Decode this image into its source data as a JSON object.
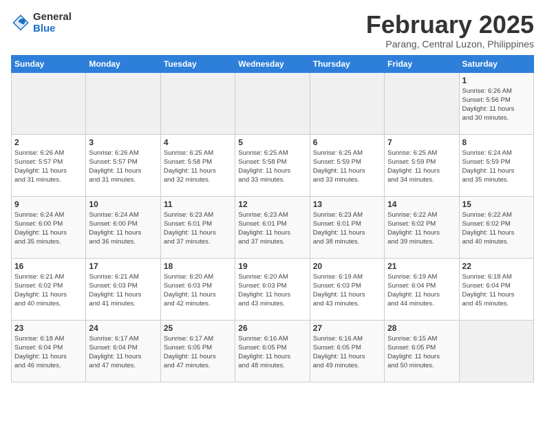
{
  "header": {
    "logo_general": "General",
    "logo_blue": "Blue",
    "month_year": "February 2025",
    "location": "Parang, Central Luzon, Philippines"
  },
  "days_of_week": [
    "Sunday",
    "Monday",
    "Tuesday",
    "Wednesday",
    "Thursday",
    "Friday",
    "Saturday"
  ],
  "weeks": [
    [
      {
        "day": "",
        "info": ""
      },
      {
        "day": "",
        "info": ""
      },
      {
        "day": "",
        "info": ""
      },
      {
        "day": "",
        "info": ""
      },
      {
        "day": "",
        "info": ""
      },
      {
        "day": "",
        "info": ""
      },
      {
        "day": "1",
        "info": "Sunrise: 6:26 AM\nSunset: 5:56 PM\nDaylight: 11 hours\nand 30 minutes."
      }
    ],
    [
      {
        "day": "2",
        "info": "Sunrise: 6:26 AM\nSunset: 5:57 PM\nDaylight: 11 hours\nand 31 minutes."
      },
      {
        "day": "3",
        "info": "Sunrise: 6:26 AM\nSunset: 5:57 PM\nDaylight: 11 hours\nand 31 minutes."
      },
      {
        "day": "4",
        "info": "Sunrise: 6:25 AM\nSunset: 5:58 PM\nDaylight: 11 hours\nand 32 minutes."
      },
      {
        "day": "5",
        "info": "Sunrise: 6:25 AM\nSunset: 5:58 PM\nDaylight: 11 hours\nand 33 minutes."
      },
      {
        "day": "6",
        "info": "Sunrise: 6:25 AM\nSunset: 5:59 PM\nDaylight: 11 hours\nand 33 minutes."
      },
      {
        "day": "7",
        "info": "Sunrise: 6:25 AM\nSunset: 5:59 PM\nDaylight: 11 hours\nand 34 minutes."
      },
      {
        "day": "8",
        "info": "Sunrise: 6:24 AM\nSunset: 5:59 PM\nDaylight: 11 hours\nand 35 minutes."
      }
    ],
    [
      {
        "day": "9",
        "info": "Sunrise: 6:24 AM\nSunset: 6:00 PM\nDaylight: 11 hours\nand 35 minutes."
      },
      {
        "day": "10",
        "info": "Sunrise: 6:24 AM\nSunset: 6:00 PM\nDaylight: 11 hours\nand 36 minutes."
      },
      {
        "day": "11",
        "info": "Sunrise: 6:23 AM\nSunset: 6:01 PM\nDaylight: 11 hours\nand 37 minutes."
      },
      {
        "day": "12",
        "info": "Sunrise: 6:23 AM\nSunset: 6:01 PM\nDaylight: 11 hours\nand 37 minutes."
      },
      {
        "day": "13",
        "info": "Sunrise: 6:23 AM\nSunset: 6:01 PM\nDaylight: 11 hours\nand 38 minutes."
      },
      {
        "day": "14",
        "info": "Sunrise: 6:22 AM\nSunset: 6:02 PM\nDaylight: 11 hours\nand 39 minutes."
      },
      {
        "day": "15",
        "info": "Sunrise: 6:22 AM\nSunset: 6:02 PM\nDaylight: 11 hours\nand 40 minutes."
      }
    ],
    [
      {
        "day": "16",
        "info": "Sunrise: 6:21 AM\nSunset: 6:02 PM\nDaylight: 11 hours\nand 40 minutes."
      },
      {
        "day": "17",
        "info": "Sunrise: 6:21 AM\nSunset: 6:03 PM\nDaylight: 11 hours\nand 41 minutes."
      },
      {
        "day": "18",
        "info": "Sunrise: 6:20 AM\nSunset: 6:03 PM\nDaylight: 11 hours\nand 42 minutes."
      },
      {
        "day": "19",
        "info": "Sunrise: 6:20 AM\nSunset: 6:03 PM\nDaylight: 11 hours\nand 43 minutes."
      },
      {
        "day": "20",
        "info": "Sunrise: 6:19 AM\nSunset: 6:03 PM\nDaylight: 11 hours\nand 43 minutes."
      },
      {
        "day": "21",
        "info": "Sunrise: 6:19 AM\nSunset: 6:04 PM\nDaylight: 11 hours\nand 44 minutes."
      },
      {
        "day": "22",
        "info": "Sunrise: 6:18 AM\nSunset: 6:04 PM\nDaylight: 11 hours\nand 45 minutes."
      }
    ],
    [
      {
        "day": "23",
        "info": "Sunrise: 6:18 AM\nSunset: 6:04 PM\nDaylight: 11 hours\nand 46 minutes."
      },
      {
        "day": "24",
        "info": "Sunrise: 6:17 AM\nSunset: 6:04 PM\nDaylight: 11 hours\nand 47 minutes."
      },
      {
        "day": "25",
        "info": "Sunrise: 6:17 AM\nSunset: 6:05 PM\nDaylight: 11 hours\nand 47 minutes."
      },
      {
        "day": "26",
        "info": "Sunrise: 6:16 AM\nSunset: 6:05 PM\nDaylight: 11 hours\nand 48 minutes."
      },
      {
        "day": "27",
        "info": "Sunrise: 6:16 AM\nSunset: 6:05 PM\nDaylight: 11 hours\nand 49 minutes."
      },
      {
        "day": "28",
        "info": "Sunrise: 6:15 AM\nSunset: 6:05 PM\nDaylight: 11 hours\nand 50 minutes."
      },
      {
        "day": "",
        "info": ""
      }
    ]
  ]
}
